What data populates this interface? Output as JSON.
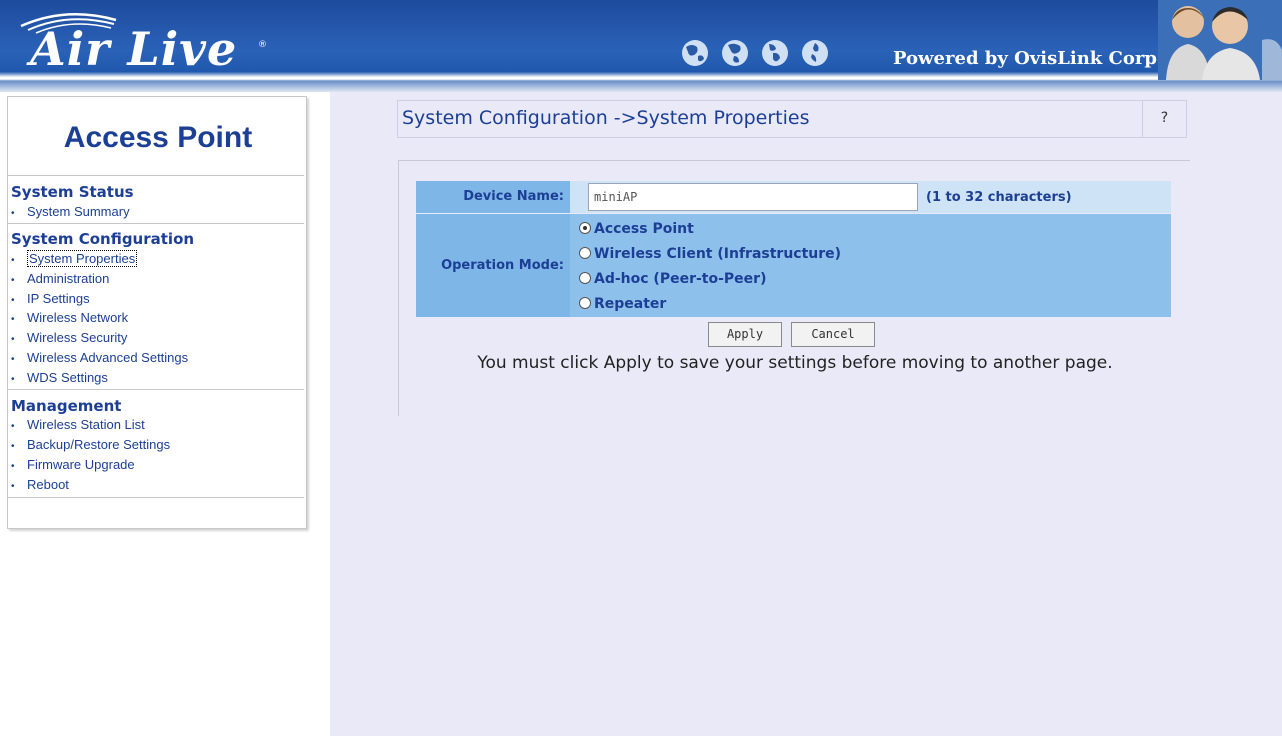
{
  "header": {
    "logo": "Air Live",
    "powered_by": "Powered by OvisLink Corp."
  },
  "sidebar": {
    "title": "Access Point",
    "sections": [
      {
        "heading": "System Status",
        "items": [
          "System Summary"
        ]
      },
      {
        "heading": "System Configuration",
        "items": [
          "System Properties",
          "Administration",
          "IP Settings",
          "Wireless Network",
          "Wireless Security",
          "Wireless Advanced Settings",
          "WDS Settings"
        ]
      },
      {
        "heading": "Management",
        "items": [
          "Wireless Station List",
          "Backup/Restore Settings",
          "Firmware Upgrade",
          "Reboot"
        ]
      }
    ],
    "active_item": "System Properties"
  },
  "main": {
    "title": "System Configuration ->System Properties",
    "help": "?",
    "form": {
      "device_name_label": "Device Name:",
      "device_name_value": "miniAP",
      "device_name_hint": "(1 to 32 characters)",
      "operation_mode_label": "Operation Mode:",
      "modes": [
        "Access Point",
        "Wireless Client (Infrastructure)",
        "Ad-hoc (Peer-to-Peer)",
        "Repeater"
      ],
      "selected_mode": "Access Point"
    },
    "buttons": {
      "apply": "Apply",
      "cancel": "Cancel"
    },
    "notice": "You must click Apply to save your settings before moving to another page."
  }
}
